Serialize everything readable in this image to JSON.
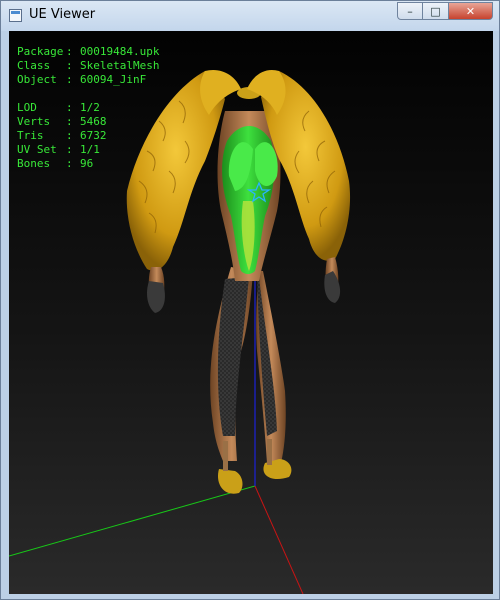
{
  "window": {
    "title": "UE Viewer",
    "controls": {
      "minimize": "–",
      "maximize": "□",
      "close": "✕"
    }
  },
  "info": {
    "rows": [
      {
        "label": "Package",
        "sep": ":",
        "value": "00019484.upk"
      },
      {
        "label": "Class",
        "sep": ":",
        "value": "SkeletalMesh"
      },
      {
        "label": "Object",
        "sep": ":",
        "value": "60094_JinF"
      },
      {
        "label": "LOD",
        "sep": ":",
        "value": "1/2"
      },
      {
        "label": "Verts",
        "sep": ":",
        "value": "5468"
      },
      {
        "label": "Tris",
        "sep": ":",
        "value": "6732"
      },
      {
        "label": "UV Set",
        "sep": ":",
        "value": "1/1"
      },
      {
        "label": "Bones",
        "sep": ":",
        "value": "96"
      }
    ]
  },
  "colors": {
    "info_text": "#38e838",
    "axis_x": "#c81414",
    "axis_y": "#18c818",
    "axis_z": "#1c22d8",
    "feather": "#d9a614",
    "suit": "#2ec42e"
  },
  "icons": {
    "app": "app-window-icon"
  }
}
